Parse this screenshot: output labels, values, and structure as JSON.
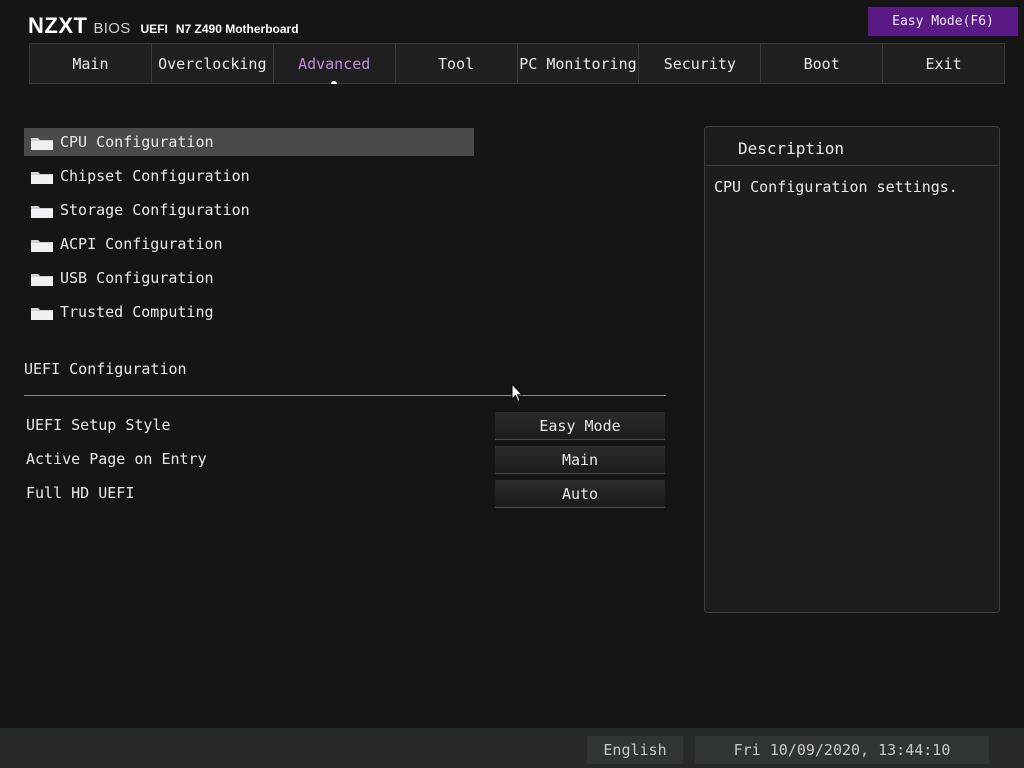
{
  "header": {
    "brand": "NZXT",
    "product": "BIOS",
    "uefi": "UEFI",
    "board": "N7 Z490 Motherboard",
    "easy_mode_label": "Easy Mode(F6)"
  },
  "tabs": [
    {
      "label": "Main"
    },
    {
      "label": "Overclocking"
    },
    {
      "label": "Advanced",
      "active": true
    },
    {
      "label": "Tool"
    },
    {
      "label": "PC Monitoring"
    },
    {
      "label": "Security"
    },
    {
      "label": "Boot"
    },
    {
      "label": "Exit"
    }
  ],
  "submenu": [
    {
      "label": "CPU Configuration",
      "icon": "folder-icon",
      "selected": true
    },
    {
      "label": "Chipset Configuration",
      "icon": "folder-icon"
    },
    {
      "label": "Storage Configuration",
      "icon": "folder-icon"
    },
    {
      "label": "ACPI Configuration",
      "icon": "folder-icon"
    },
    {
      "label": "USB Configuration",
      "icon": "folder-icon"
    },
    {
      "label": "Trusted Computing",
      "icon": "folder-icon"
    }
  ],
  "uefi_config": {
    "title": "UEFI Configuration",
    "settings": [
      {
        "label": "UEFI Setup Style",
        "value": "Easy Mode"
      },
      {
        "label": "Active Page on Entry",
        "value": "Main"
      },
      {
        "label": "Full HD UEFI",
        "value": "Auto"
      }
    ]
  },
  "description": {
    "title": "Description",
    "text": "CPU Configuration settings."
  },
  "footer": {
    "language": "English",
    "datetime": "Fri 10/09/2020, 13:44:10"
  },
  "colors": {
    "background": "#151515",
    "accent": "#5a1a86",
    "active_tab_text": "#c08be2",
    "selected_row": "#4a4a4a",
    "footer": "#262a2b"
  }
}
